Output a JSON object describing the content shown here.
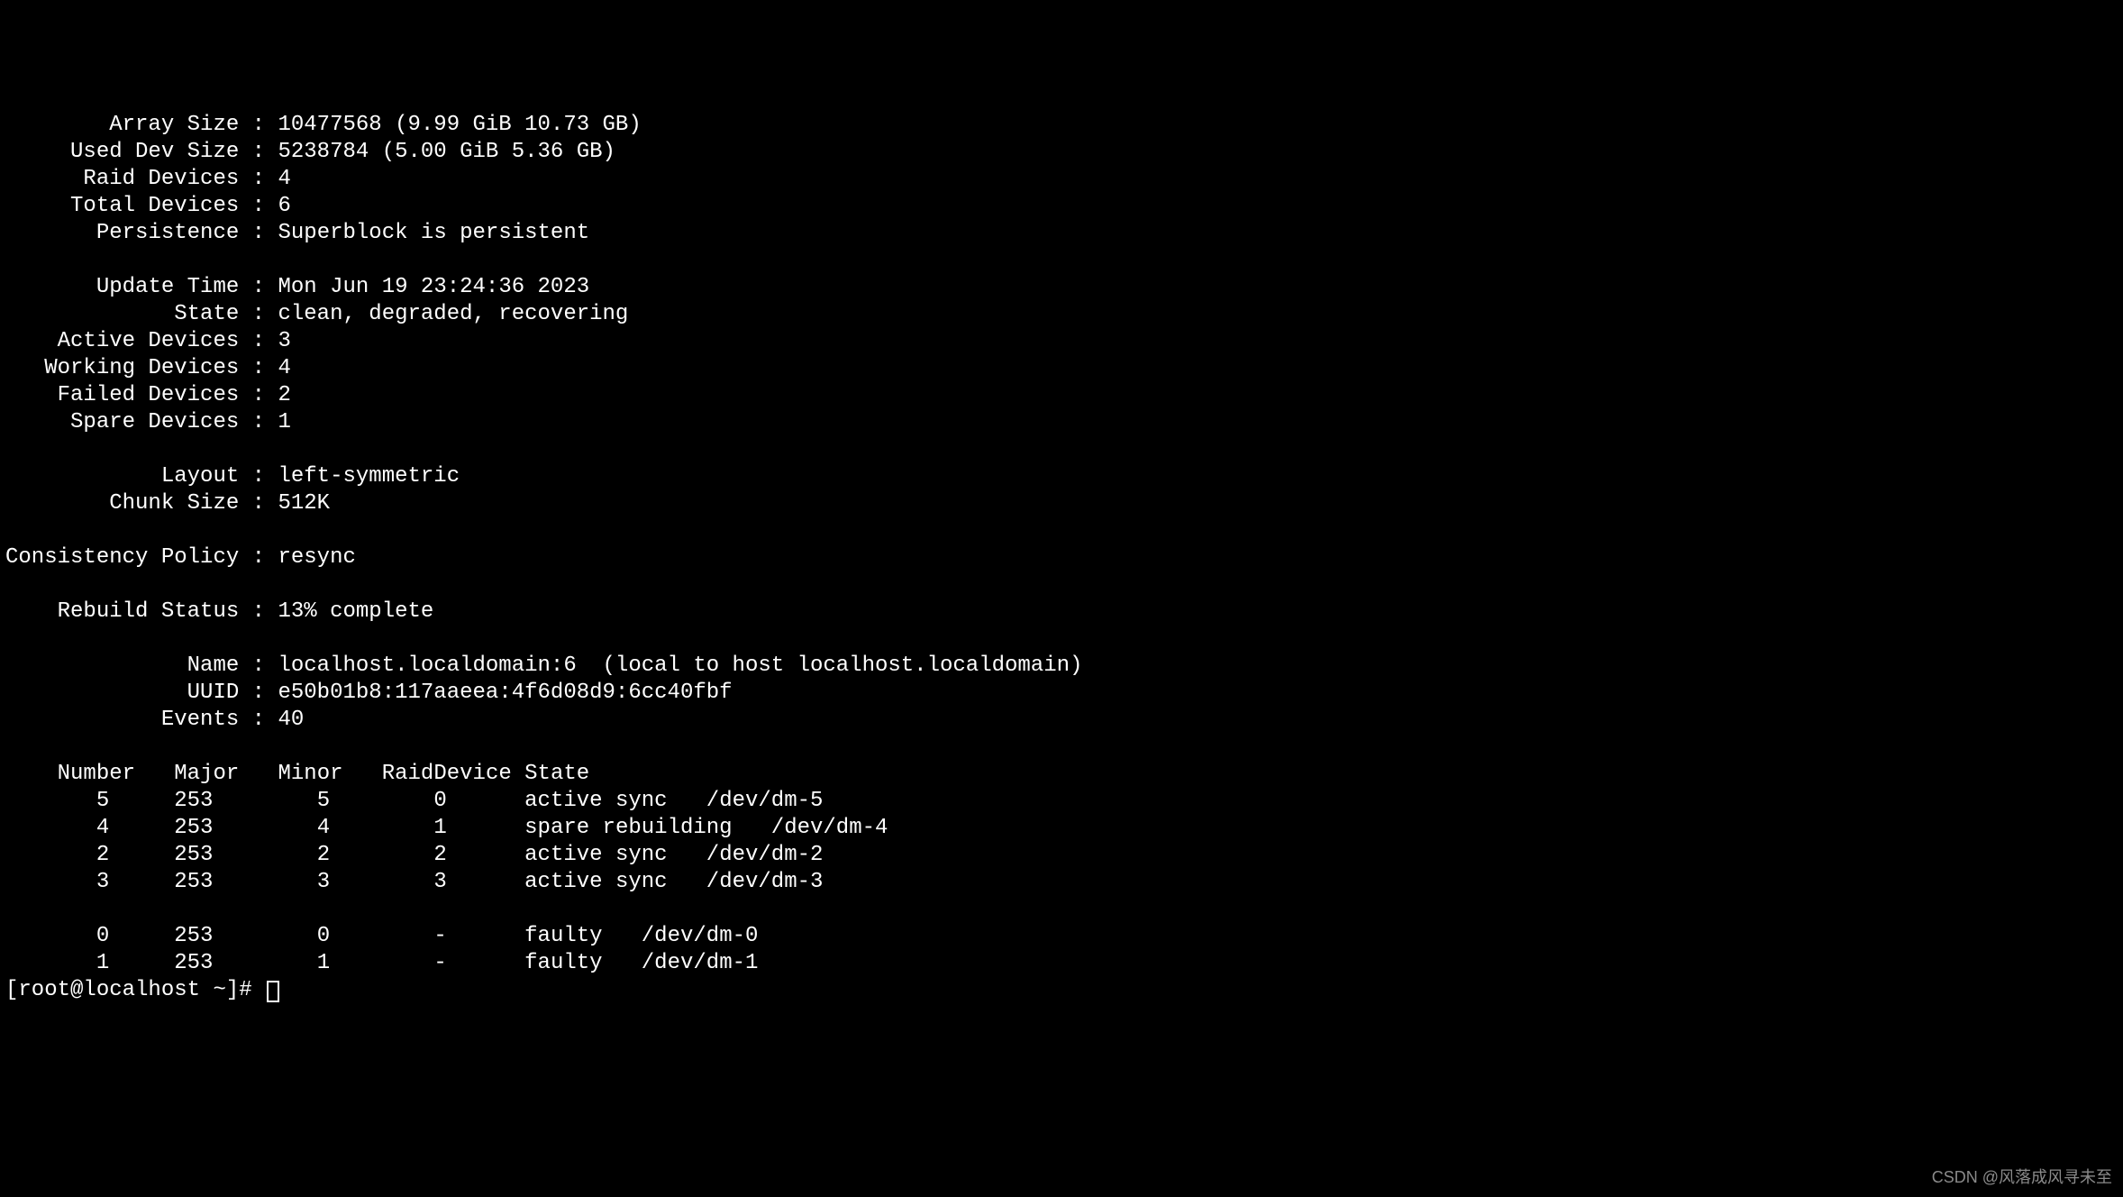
{
  "fields": {
    "array_size": {
      "label": "Array Size",
      "value": "10477568 (9.99 GiB 10.73 GB)"
    },
    "used_dev_size": {
      "label": "Used Dev Size",
      "value": "5238784 (5.00 GiB 5.36 GB)"
    },
    "raid_devices": {
      "label": "Raid Devices",
      "value": "4"
    },
    "total_devices": {
      "label": "Total Devices",
      "value": "6"
    },
    "persistence": {
      "label": "Persistence",
      "value": "Superblock is persistent"
    },
    "update_time": {
      "label": "Update Time",
      "value": "Mon Jun 19 23:24:36 2023"
    },
    "state": {
      "label": "State",
      "value": "clean, degraded, recovering"
    },
    "active_devices": {
      "label": "Active Devices",
      "value": "3"
    },
    "working_devices": {
      "label": "Working Devices",
      "value": "4"
    },
    "failed_devices": {
      "label": "Failed Devices",
      "value": "2"
    },
    "spare_devices": {
      "label": "Spare Devices",
      "value": "1"
    },
    "layout": {
      "label": "Layout",
      "value": "left-symmetric"
    },
    "chunk_size": {
      "label": "Chunk Size",
      "value": "512K"
    },
    "consistency_policy": {
      "label": "Consistency Policy",
      "value": "resync"
    },
    "rebuild_status": {
      "label": "Rebuild Status",
      "value": "13% complete"
    },
    "name": {
      "label": "Name",
      "value": "localhost.localdomain:6  (local to host localhost.localdomain)"
    },
    "uuid": {
      "label": "UUID",
      "value": "e50b01b8:117aaeea:4f6d08d9:6cc40fbf"
    },
    "events": {
      "label": "Events",
      "value": "40"
    }
  },
  "device_table": {
    "headers": {
      "number": "Number",
      "major": "Major",
      "minor": "Minor",
      "raid_device": "RaidDevice",
      "state": "State"
    },
    "rows": [
      {
        "number": "5",
        "major": "253",
        "minor": "5",
        "raid_device": "0",
        "state": "active sync",
        "path": "/dev/dm-5"
      },
      {
        "number": "4",
        "major": "253",
        "minor": "4",
        "raid_device": "1",
        "state": "spare rebuilding",
        "path": "/dev/dm-4"
      },
      {
        "number": "2",
        "major": "253",
        "minor": "2",
        "raid_device": "2",
        "state": "active sync",
        "path": "/dev/dm-2"
      },
      {
        "number": "3",
        "major": "253",
        "minor": "3",
        "raid_device": "3",
        "state": "active sync",
        "path": "/dev/dm-3"
      }
    ],
    "spare_rows": [
      {
        "number": "0",
        "major": "253",
        "minor": "0",
        "raid_device": "-",
        "state": "faulty",
        "path": "/dev/dm-0"
      },
      {
        "number": "1",
        "major": "253",
        "minor": "1",
        "raid_device": "-",
        "state": "faulty",
        "path": "/dev/dm-1"
      }
    ]
  },
  "prompt": "[root@localhost ~]# ",
  "watermark": "CSDN @风落成风寻未至"
}
